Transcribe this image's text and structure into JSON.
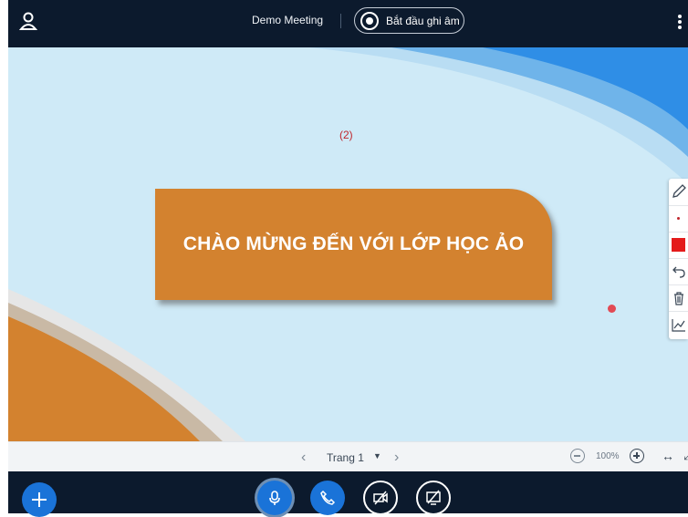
{
  "header": {
    "meeting_title": "Demo Meeting",
    "record_label": "Bắt đầu ghi âm"
  },
  "slide": {
    "banner_text": "CHÀO MỪNG ĐẾN VỚI LỚP HỌC ẢO",
    "page_note": "(2)",
    "colors": {
      "banner": "#d3822f",
      "background": "#cfeaf7",
      "accent_blue": "#2f8ee6",
      "orange": "#d3822f"
    }
  },
  "toolbar": {
    "icons": [
      "pencil-icon",
      "dot-size-icon",
      "color-swatch-icon",
      "undo-icon",
      "trash-icon",
      "graph-icon"
    ],
    "swatch_color": "#e41b1b"
  },
  "pager": {
    "page_label": "Trang 1",
    "zoom_label": "100%"
  },
  "controls": {
    "icons": [
      "plus-icon",
      "microphone-icon",
      "phone-icon",
      "camera-off-icon",
      "screen-share-off-icon"
    ],
    "accent": "#1a73d8"
  }
}
